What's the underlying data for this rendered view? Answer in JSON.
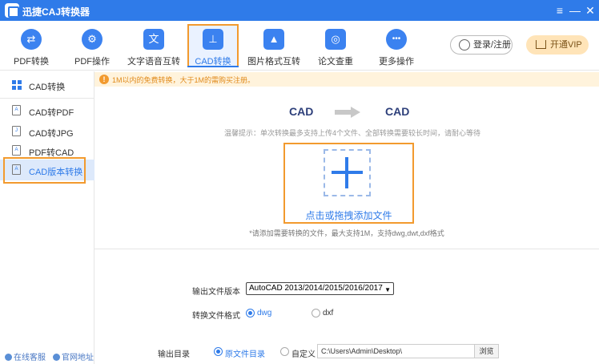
{
  "app": {
    "title": "迅捷CAJ转换器"
  },
  "window_controls": {
    "menu": "≡",
    "minimize": "—",
    "close": "✕"
  },
  "toolbar": {
    "items": [
      {
        "label": "PDF转换",
        "icon": "swap-icon",
        "glyph": "⇄"
      },
      {
        "label": "PDF操作",
        "icon": "gear-icon",
        "glyph": "⚙"
      },
      {
        "label": "文字语音互转",
        "icon": "text-speech-icon",
        "glyph": "文"
      },
      {
        "label": "CAD转换",
        "icon": "cad-icon",
        "glyph": "⊥",
        "active": true
      },
      {
        "label": "图片格式互转",
        "icon": "image-icon",
        "glyph": "▲"
      },
      {
        "label": "论文查重",
        "icon": "search-doc-icon",
        "glyph": "◎"
      },
      {
        "label": "更多操作",
        "icon": "more-icon",
        "glyph": "•••"
      }
    ],
    "login_label": "登录/注册",
    "vip_label": "开通VIP"
  },
  "sidebar": {
    "header": "CAD转换",
    "items": [
      {
        "label": "CAD转PDF",
        "glyph": "A"
      },
      {
        "label": "CAD转JPG",
        "glyph": "J"
      },
      {
        "label": "PDF转CAD",
        "glyph": "A"
      },
      {
        "label": "CAD版本转换",
        "glyph": "A",
        "active": true
      }
    ],
    "footer": {
      "service": "在线客服",
      "website": "官网地址"
    }
  },
  "notice": {
    "icon": "!",
    "text": "1M以内的免费转换，大于1M的需购买注册。"
  },
  "converter": {
    "from": "CAD",
    "to": "CAD",
    "tip": "温馨提示：单次转换最多支持上传4个文件、全部转换需要较长时间，请耐心等待",
    "drop_label": "点击或拖拽添加文件",
    "drop_note": "*请添加需要转换的文件，最大支持1M，支持dwg,dwt,dxf格式"
  },
  "options": {
    "version_label": "输出文件版本",
    "version_value": "AutoCAD 2013/2014/2015/2016/2017",
    "format_label": "转换文件格式",
    "format_options": [
      "dwg",
      "dxf"
    ],
    "format_selected": "dwg",
    "output_label": "输出目录",
    "output_options": [
      "原文件目录",
      "自定义"
    ],
    "output_selected": "原文件目录",
    "path_value": "C:\\Users\\Admin\\Desktop\\",
    "browse_label": "浏览"
  },
  "colors": {
    "primary": "#2f7be9",
    "highlight": "#f29a2e",
    "notice_bg": "#fff3dc",
    "vip_bg": "#ffe4b8"
  }
}
